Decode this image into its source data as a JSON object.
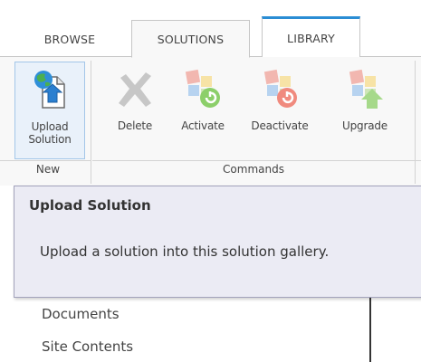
{
  "tabs": [
    {
      "label": "BROWSE",
      "active": false
    },
    {
      "label": "SOLUTIONS",
      "active": true
    },
    {
      "label": "LIBRARY",
      "active": false
    }
  ],
  "ribbon": {
    "groups": {
      "new": "New",
      "commands": "Commands"
    },
    "buttons": {
      "upload": {
        "label": "Upload\nSolution",
        "icon": "upload-solution-icon"
      },
      "delete": {
        "label": "Delete",
        "icon": "delete-x-icon"
      },
      "activate": {
        "label": "Activate",
        "icon": "activate-icon"
      },
      "deactivate": {
        "label": "Deactivate",
        "icon": "deactivate-icon"
      },
      "upgrade": {
        "label": "Upgrade",
        "icon": "upgrade-icon"
      }
    }
  },
  "tooltip": {
    "title": "Upload Solution",
    "body": "Upload a solution into this solution gallery."
  },
  "nav": {
    "items": [
      "Documents",
      "Site Contents"
    ]
  },
  "colors": {
    "accent": "#2a8dd4",
    "ribbon_bg": "#f8f8f8",
    "tooltip_bg": "#ebebf4",
    "tooltip_border": "#a2a2bb"
  }
}
